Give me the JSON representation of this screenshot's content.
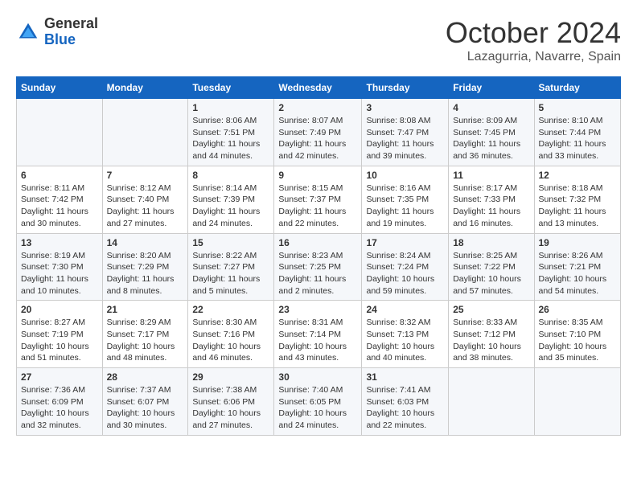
{
  "header": {
    "logo_general": "General",
    "logo_blue": "Blue",
    "month_title": "October 2024",
    "subtitle": "Lazagurria, Navarre, Spain"
  },
  "days_of_week": [
    "Sunday",
    "Monday",
    "Tuesday",
    "Wednesday",
    "Thursday",
    "Friday",
    "Saturday"
  ],
  "weeks": [
    [
      {
        "day": "",
        "info": ""
      },
      {
        "day": "",
        "info": ""
      },
      {
        "day": "1",
        "info": "Sunrise: 8:06 AM\nSunset: 7:51 PM\nDaylight: 11 hours and 44 minutes."
      },
      {
        "day": "2",
        "info": "Sunrise: 8:07 AM\nSunset: 7:49 PM\nDaylight: 11 hours and 42 minutes."
      },
      {
        "day": "3",
        "info": "Sunrise: 8:08 AM\nSunset: 7:47 PM\nDaylight: 11 hours and 39 minutes."
      },
      {
        "day": "4",
        "info": "Sunrise: 8:09 AM\nSunset: 7:45 PM\nDaylight: 11 hours and 36 minutes."
      },
      {
        "day": "5",
        "info": "Sunrise: 8:10 AM\nSunset: 7:44 PM\nDaylight: 11 hours and 33 minutes."
      }
    ],
    [
      {
        "day": "6",
        "info": "Sunrise: 8:11 AM\nSunset: 7:42 PM\nDaylight: 11 hours and 30 minutes."
      },
      {
        "day": "7",
        "info": "Sunrise: 8:12 AM\nSunset: 7:40 PM\nDaylight: 11 hours and 27 minutes."
      },
      {
        "day": "8",
        "info": "Sunrise: 8:14 AM\nSunset: 7:39 PM\nDaylight: 11 hours and 24 minutes."
      },
      {
        "day": "9",
        "info": "Sunrise: 8:15 AM\nSunset: 7:37 PM\nDaylight: 11 hours and 22 minutes."
      },
      {
        "day": "10",
        "info": "Sunrise: 8:16 AM\nSunset: 7:35 PM\nDaylight: 11 hours and 19 minutes."
      },
      {
        "day": "11",
        "info": "Sunrise: 8:17 AM\nSunset: 7:33 PM\nDaylight: 11 hours and 16 minutes."
      },
      {
        "day": "12",
        "info": "Sunrise: 8:18 AM\nSunset: 7:32 PM\nDaylight: 11 hours and 13 minutes."
      }
    ],
    [
      {
        "day": "13",
        "info": "Sunrise: 8:19 AM\nSunset: 7:30 PM\nDaylight: 11 hours and 10 minutes."
      },
      {
        "day": "14",
        "info": "Sunrise: 8:20 AM\nSunset: 7:29 PM\nDaylight: 11 hours and 8 minutes."
      },
      {
        "day": "15",
        "info": "Sunrise: 8:22 AM\nSunset: 7:27 PM\nDaylight: 11 hours and 5 minutes."
      },
      {
        "day": "16",
        "info": "Sunrise: 8:23 AM\nSunset: 7:25 PM\nDaylight: 11 hours and 2 minutes."
      },
      {
        "day": "17",
        "info": "Sunrise: 8:24 AM\nSunset: 7:24 PM\nDaylight: 10 hours and 59 minutes."
      },
      {
        "day": "18",
        "info": "Sunrise: 8:25 AM\nSunset: 7:22 PM\nDaylight: 10 hours and 57 minutes."
      },
      {
        "day": "19",
        "info": "Sunrise: 8:26 AM\nSunset: 7:21 PM\nDaylight: 10 hours and 54 minutes."
      }
    ],
    [
      {
        "day": "20",
        "info": "Sunrise: 8:27 AM\nSunset: 7:19 PM\nDaylight: 10 hours and 51 minutes."
      },
      {
        "day": "21",
        "info": "Sunrise: 8:29 AM\nSunset: 7:17 PM\nDaylight: 10 hours and 48 minutes."
      },
      {
        "day": "22",
        "info": "Sunrise: 8:30 AM\nSunset: 7:16 PM\nDaylight: 10 hours and 46 minutes."
      },
      {
        "day": "23",
        "info": "Sunrise: 8:31 AM\nSunset: 7:14 PM\nDaylight: 10 hours and 43 minutes."
      },
      {
        "day": "24",
        "info": "Sunrise: 8:32 AM\nSunset: 7:13 PM\nDaylight: 10 hours and 40 minutes."
      },
      {
        "day": "25",
        "info": "Sunrise: 8:33 AM\nSunset: 7:12 PM\nDaylight: 10 hours and 38 minutes."
      },
      {
        "day": "26",
        "info": "Sunrise: 8:35 AM\nSunset: 7:10 PM\nDaylight: 10 hours and 35 minutes."
      }
    ],
    [
      {
        "day": "27",
        "info": "Sunrise: 7:36 AM\nSunset: 6:09 PM\nDaylight: 10 hours and 32 minutes."
      },
      {
        "day": "28",
        "info": "Sunrise: 7:37 AM\nSunset: 6:07 PM\nDaylight: 10 hours and 30 minutes."
      },
      {
        "day": "29",
        "info": "Sunrise: 7:38 AM\nSunset: 6:06 PM\nDaylight: 10 hours and 27 minutes."
      },
      {
        "day": "30",
        "info": "Sunrise: 7:40 AM\nSunset: 6:05 PM\nDaylight: 10 hours and 24 minutes."
      },
      {
        "day": "31",
        "info": "Sunrise: 7:41 AM\nSunset: 6:03 PM\nDaylight: 10 hours and 22 minutes."
      },
      {
        "day": "",
        "info": ""
      },
      {
        "day": "",
        "info": ""
      }
    ]
  ]
}
